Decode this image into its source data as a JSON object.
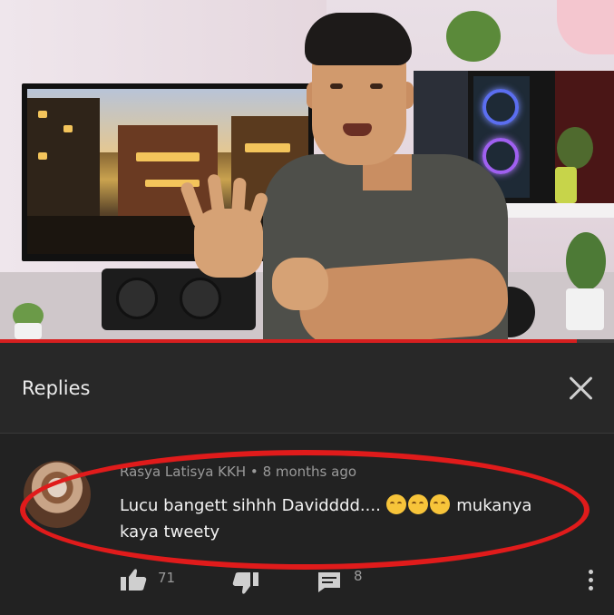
{
  "panel": {
    "title": "Replies"
  },
  "comment": {
    "author": "Rasya Latisya KKH",
    "time": "8 months ago",
    "separator": "•",
    "text_before_emoji": "Lucu bangett sihhh Davidddd.... ",
    "text_after_emoji": " mukanya kaya tweety",
    "emoji_count": 3,
    "likes": "71",
    "replies": "8"
  },
  "video": {
    "progress": 0.94
  },
  "colors": {
    "panel_bg": "#282828",
    "comment_bg": "#222222",
    "progress_red": "#d61f1f",
    "highlight_red": "#e01b1b"
  },
  "icons": [
    "close-icon",
    "thumbs-up-icon",
    "thumbs-down-icon",
    "reply-icon",
    "more-vertical-icon"
  ]
}
